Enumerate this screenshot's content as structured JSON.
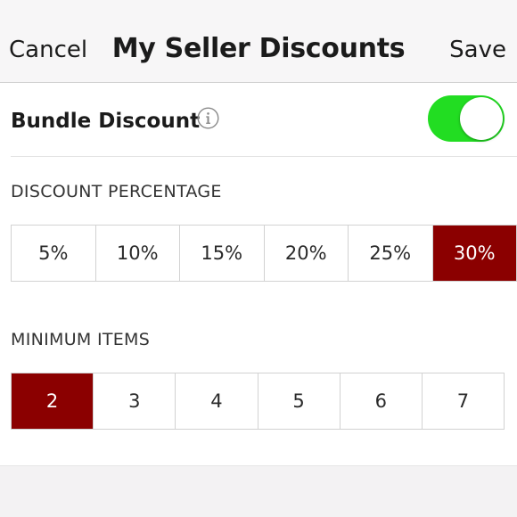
{
  "header": {
    "cancel_label": "Cancel",
    "title": "My Seller Discounts",
    "save_label": "Save"
  },
  "bundle": {
    "label": "Bundle Discount",
    "info_icon": "info-circle-icon",
    "toggle_on": true,
    "toggle_color": "#22dd22"
  },
  "discount": {
    "section_label": "DISCOUNT PERCENTAGE",
    "options": [
      "5%",
      "10%",
      "15%",
      "20%",
      "25%",
      "30%"
    ],
    "selected_index": 5
  },
  "minimum": {
    "section_label": "MINIMUM ITEMS",
    "options": [
      "2",
      "3",
      "4",
      "5",
      "6",
      "7"
    ],
    "selected_index": 0
  },
  "colors": {
    "selected": "#8b0000",
    "toggle_on": "#22dd22"
  }
}
